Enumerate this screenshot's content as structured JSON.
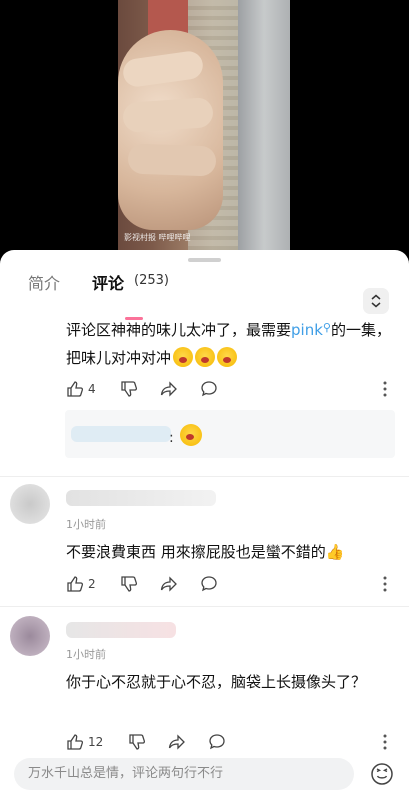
{
  "video": {
    "watermark": "影视村报 哔哩哔哩"
  },
  "tabs": {
    "intro": "简介",
    "comments": "评论",
    "comment_count": "(253)"
  },
  "comments": [
    {
      "text_before": "评论区神神的味儿太冲了，最需要",
      "link": "pink",
      "text_after": "的一集，把味儿对冲对冲",
      "likes": "4",
      "reply_suffix": ":"
    },
    {
      "time": "1小时前",
      "text": "不要浪費東西 用來擦屁股也是蠻不錯的",
      "likes": "2"
    },
    {
      "time": "1小时前",
      "text": "你于心不忍就于心不忍，脑袋上长摄像头了？",
      "likes": "12"
    }
  ],
  "input": {
    "placeholder": "万水千山总是情，评论两句行不行"
  },
  "colors": {
    "accent_pink": "#fb7299",
    "link_blue": "#3f9ee6"
  }
}
